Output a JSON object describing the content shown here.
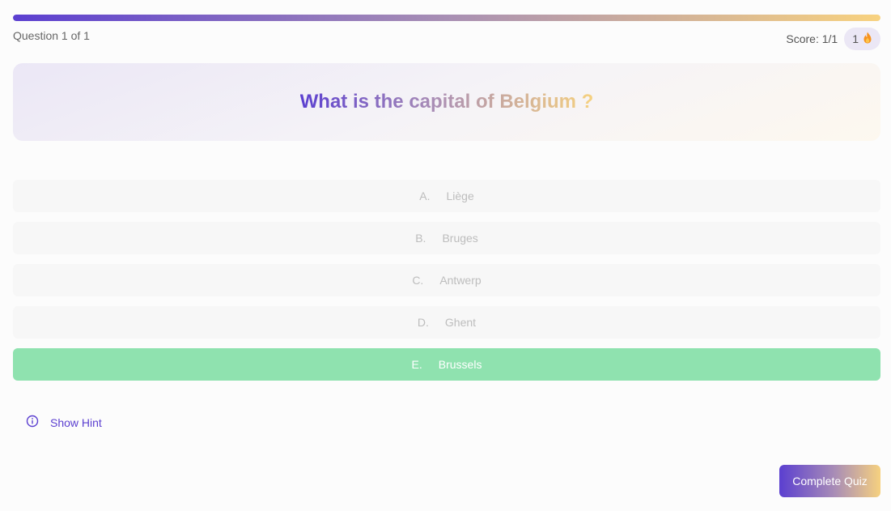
{
  "progress": {
    "current": 1,
    "total": 1,
    "fraction": 1.0
  },
  "header": {
    "question_counter": "Question 1 of 1",
    "score_label": "Score: 1/1",
    "streak_count": "1",
    "streak_icon": "fire-icon"
  },
  "question": {
    "text": "What is the capital of Belgium ?"
  },
  "options": [
    {
      "letter": "A.",
      "text": "Liège",
      "state": "disabled"
    },
    {
      "letter": "B.",
      "text": "Bruges",
      "state": "disabled"
    },
    {
      "letter": "C.",
      "text": "Antwerp",
      "state": "disabled"
    },
    {
      "letter": "D.",
      "text": "Ghent",
      "state": "disabled"
    },
    {
      "letter": "E.",
      "text": "Brussels",
      "state": "correct"
    }
  ],
  "hint": {
    "label": "Show Hint",
    "icon": "info-icon"
  },
  "actions": {
    "complete_label": "Complete Quiz"
  },
  "colors": {
    "accent": "#5b3fd0",
    "gradient_end": "#f6d17f",
    "correct": "#8fe2af"
  }
}
